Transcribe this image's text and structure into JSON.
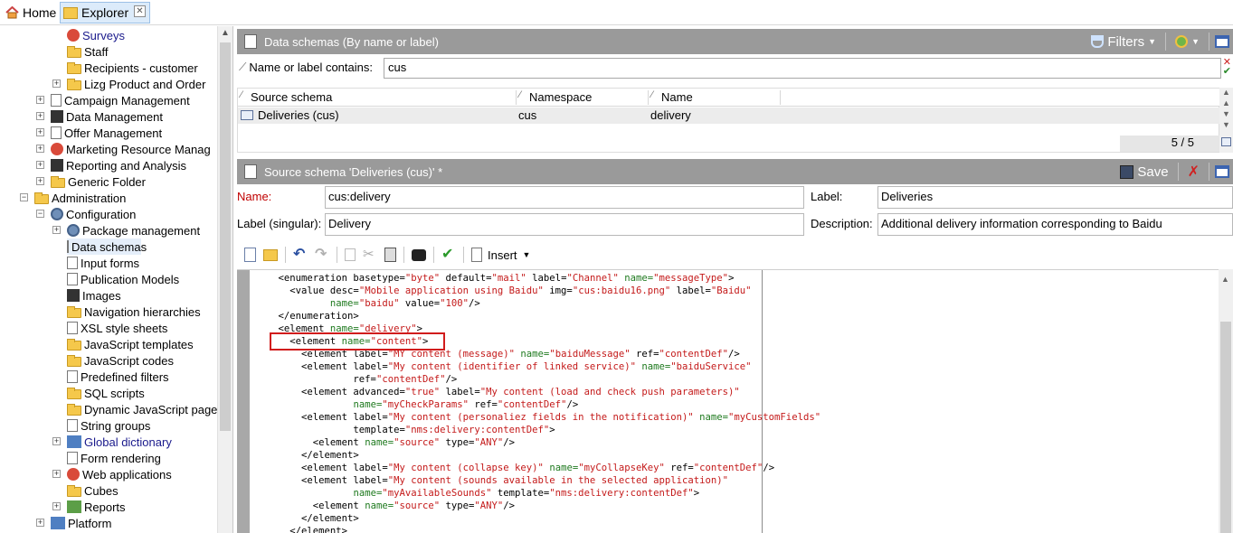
{
  "tabs": [
    {
      "label": "Home"
    },
    {
      "label": "Explorer"
    }
  ],
  "tree": [
    {
      "label": "Surveys",
      "icon": "survey-icon",
      "link": true
    },
    {
      "label": "Staff",
      "icon": "folder-icon"
    },
    {
      "label": "Recipients - customer",
      "icon": "folder-icon"
    },
    {
      "label": "Lizg Product and Order",
      "icon": "folder-icon"
    },
    {
      "label": "Campaign Management",
      "icon": "campaign-icon"
    },
    {
      "label": "Data Management",
      "icon": "data-icon"
    },
    {
      "label": "Offer Management",
      "icon": "offer-icon"
    },
    {
      "label": "Marketing Resource Manag",
      "icon": "mrm-icon"
    },
    {
      "label": "Reporting and Analysis",
      "icon": "reporting-icon"
    },
    {
      "label": "Generic Folder",
      "icon": "folder-icon"
    },
    {
      "label": "Administration",
      "icon": "admin-icon"
    },
    {
      "label": "Configuration",
      "icon": "gear-icon"
    },
    {
      "label": "Package management",
      "icon": "package-icon"
    },
    {
      "label": "Data schemas",
      "icon": "schema-icon"
    },
    {
      "label": "Input forms",
      "icon": "form-icon"
    },
    {
      "label": "Publication Models",
      "icon": "publication-icon"
    },
    {
      "label": "Images",
      "icon": "image-icon"
    },
    {
      "label": "Navigation hierarchies",
      "icon": "folder-icon"
    },
    {
      "label": "XSL style sheets",
      "icon": "xsl-icon"
    },
    {
      "label": "JavaScript templates",
      "icon": "js-template-icon"
    },
    {
      "label": "JavaScript codes",
      "icon": "js-code-icon"
    },
    {
      "label": "Predefined filters",
      "icon": "filter-icon"
    },
    {
      "label": "SQL scripts",
      "icon": "sql-icon"
    },
    {
      "label": "Dynamic JavaScript page",
      "icon": "js-page-icon"
    },
    {
      "label": "String groups",
      "icon": "string-icon"
    },
    {
      "label": "Global dictionary",
      "icon": "dictionary-icon",
      "link": true
    },
    {
      "label": "Form rendering",
      "icon": "render-icon"
    },
    {
      "label": "Web applications",
      "icon": "web-icon"
    },
    {
      "label": "Cubes",
      "icon": "cube-icon"
    },
    {
      "label": "Reports",
      "icon": "report-icon"
    },
    {
      "label": "Platform",
      "icon": "platform-icon"
    }
  ],
  "list_pane": {
    "title": "Data schemas (By name or label)",
    "filters_label": "Filters",
    "filter_label": "Name or label contains:",
    "filter_value": "cus",
    "columns": [
      "Source schema",
      "Namespace",
      "Name"
    ],
    "rows": [
      {
        "source_schema": "Deliveries (cus)",
        "namespace": "cus",
        "name": "delivery"
      }
    ],
    "count": "5 / 5"
  },
  "detail_pane": {
    "title": "Source schema 'Deliveries (cus)' *",
    "save_label": "Save",
    "name_label": "Name:",
    "name_value": "cus:delivery",
    "label_label": "Label:",
    "label_value": "Deliveries",
    "singular_label": "Label (singular):",
    "singular_value": "Delivery",
    "description_label": "Description:",
    "description_value": "Additional delivery information corresponding to Baidu",
    "insert_label": "Insert"
  },
  "code_lines": [
    "    <enumeration basetype=\"byte\" default=\"mail\" label=\"Channel\" name=\"messageType\">",
    "      <value desc=\"Mobile application using Baidu\" img=\"cus:baidu16.png\" label=\"Baidu\"",
    "             name=\"baidu\" value=\"100\"/>",
    "    </enumeration>",
    "    <element name=\"delivery\">",
    "      <element name=\"content\">",
    "        <element label=\"MY content (message)\" name=\"baiduMessage\" ref=\"contentDef\"/>",
    "        <element label=\"My content (identifier of linked service)\" name=\"baiduService\"",
    "                 ref=\"contentDef\"/>",
    "        <element advanced=\"true\" label=\"My content (load and check push parameters)\"",
    "                 name=\"myCheckParams\" ref=\"contentDef\"/>",
    "        <element label=\"My content (personaliez fields in the notification)\" name=\"myCustomFields\"",
    "                 template=\"nms:delivery:contentDef\">",
    "          <element name=\"source\" type=\"ANY\"/>",
    "        </element>",
    "        <element label=\"My content (collapse key)\" name=\"myCollapseKey\" ref=\"contentDef\"/>",
    "        <element label=\"My content (sounds available in the selected application)\"",
    "                 name=\"myAvailableSounds\" template=\"nms:delivery:contentDef\">",
    "          <element name=\"source\" type=\"ANY\"/>",
    "        </element>",
    "      </element>"
  ]
}
